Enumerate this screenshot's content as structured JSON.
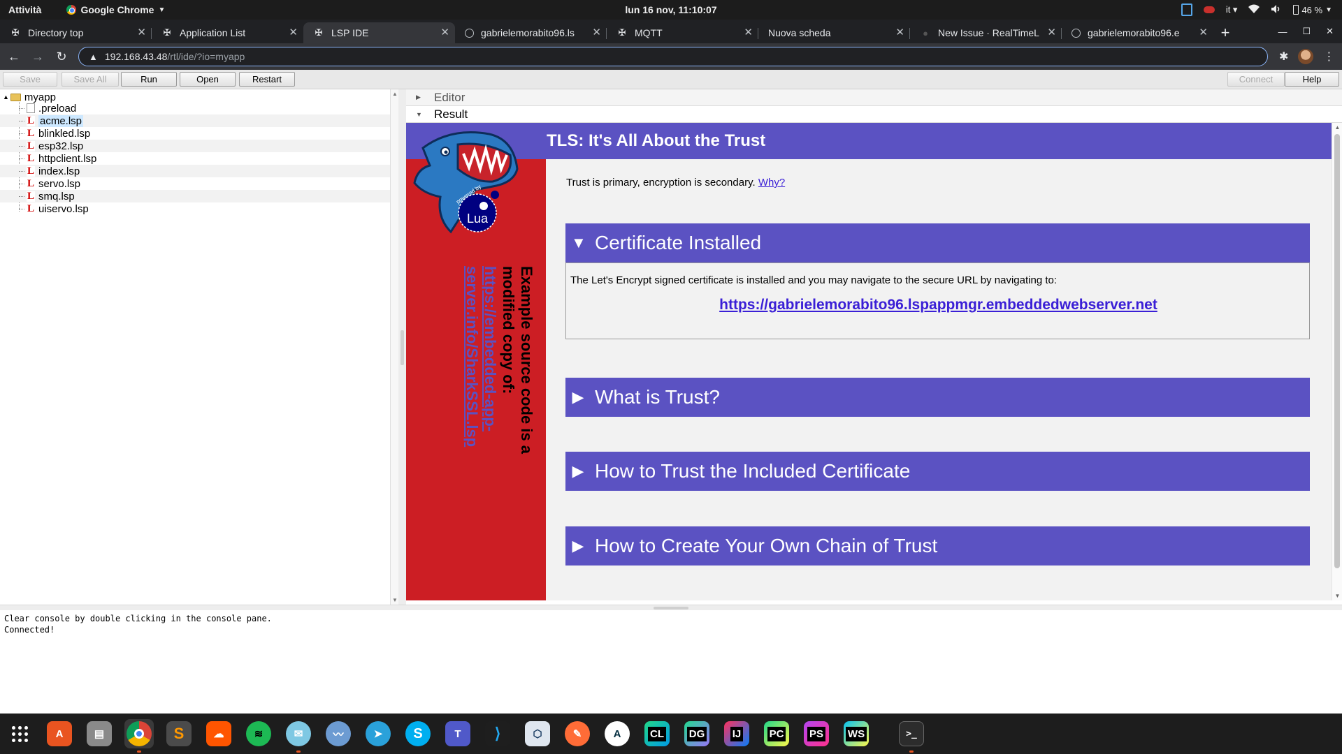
{
  "topbar": {
    "activities": "Attività",
    "app_name": "Google Chrome",
    "clock": "lun 16 nov, 11:10:07",
    "lang": "it",
    "battery": "46 %"
  },
  "tabs": [
    {
      "title": "Directory top",
      "icon": "page-icon"
    },
    {
      "title": "Application List",
      "icon": "page-icon"
    },
    {
      "title": "LSP IDE",
      "icon": "page-icon",
      "active": true
    },
    {
      "title": "gabrielemorabito96.ls",
      "icon": "globe-icon"
    },
    {
      "title": "MQTT",
      "icon": "page-icon"
    },
    {
      "title": "Nuova scheda",
      "icon": "none"
    },
    {
      "title": "New Issue · RealTimeL",
      "icon": "github-icon"
    },
    {
      "title": "gabrielemorabito96.e",
      "icon": "globe-icon"
    }
  ],
  "address": {
    "host": "192.168.43.48",
    "path": "/rtl/ide/?io=myapp"
  },
  "ide_buttons": {
    "save": "Save",
    "save_all": "Save All",
    "run": "Run",
    "open": "Open",
    "restart": "Restart",
    "connect": "Connect",
    "help": "Help"
  },
  "tree": {
    "root": "myapp",
    "files": [
      ".preload",
      "acme.lsp",
      "blinkled.lsp",
      "esp32.lsp",
      "httpclient.lsp",
      "index.lsp",
      "servo.lsp",
      "smq.lsp",
      "uiservo.lsp"
    ],
    "selected": "acme.lsp"
  },
  "panes": {
    "editor": "Editor",
    "result": "Result"
  },
  "page": {
    "header": "TLS: It's All About the Trust",
    "trust_line": "Trust is primary, encryption is secondary.",
    "why_link": "Why?",
    "mascot_powered_by": "powered by",
    "mascot_lua": "Lua",
    "side_text": "Example source code is a modified copy of:",
    "side_link": "https://embedded-app-server.info/SharkSSL.lsp",
    "sections": [
      {
        "title": "Certificate Installed",
        "expanded": true
      },
      {
        "title": "What is Trust?",
        "expanded": false
      },
      {
        "title": "How to Trust the Included Certificate",
        "expanded": false
      },
      {
        "title": "How to Create Your Own Chain of Trust",
        "expanded": false
      }
    ],
    "cert_text": "The Let's Encrypt signed certificate is installed and you may navigate to the secure URL by navigating to:",
    "cert_url": "https://gabrielemorabito96.lspappmgr.embeddedwebserver.net"
  },
  "console": {
    "line1": "Clear console by double clicking in the console pane.",
    "line2": "Connected!"
  },
  "colors": {
    "header_purple": "#5b52c2",
    "side_red": "#cc1e24",
    "link_blue": "#3a1fd6"
  }
}
